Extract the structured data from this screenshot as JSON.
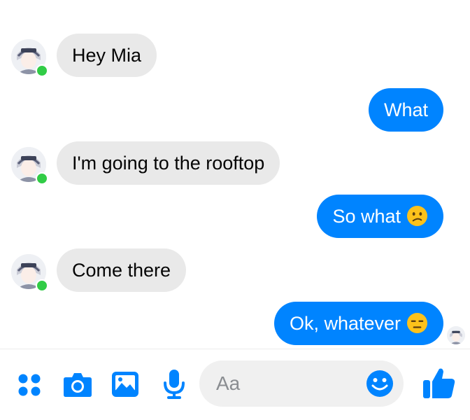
{
  "colors": {
    "accent": "#0084ff",
    "incoming_bubble": "#e9e9e9",
    "online": "#31cc46"
  },
  "messages": [
    {
      "direction": "incoming",
      "text": "Hey Mia"
    },
    {
      "direction": "outgoing",
      "text": "What"
    },
    {
      "direction": "incoming",
      "text": "I'm going to the rooftop"
    },
    {
      "direction": "outgoing",
      "text": "So what",
      "emoji": "confused-face"
    },
    {
      "direction": "incoming",
      "text": "Come there"
    },
    {
      "direction": "outgoing",
      "text": "Ok, whatever",
      "emoji": "expressionless-face"
    }
  ],
  "composer": {
    "placeholder": "Aa",
    "icons": [
      "menu-dots-icon",
      "camera-icon",
      "gallery-icon",
      "microphone-icon",
      "emoji-icon",
      "thumbs-up-icon"
    ]
  }
}
